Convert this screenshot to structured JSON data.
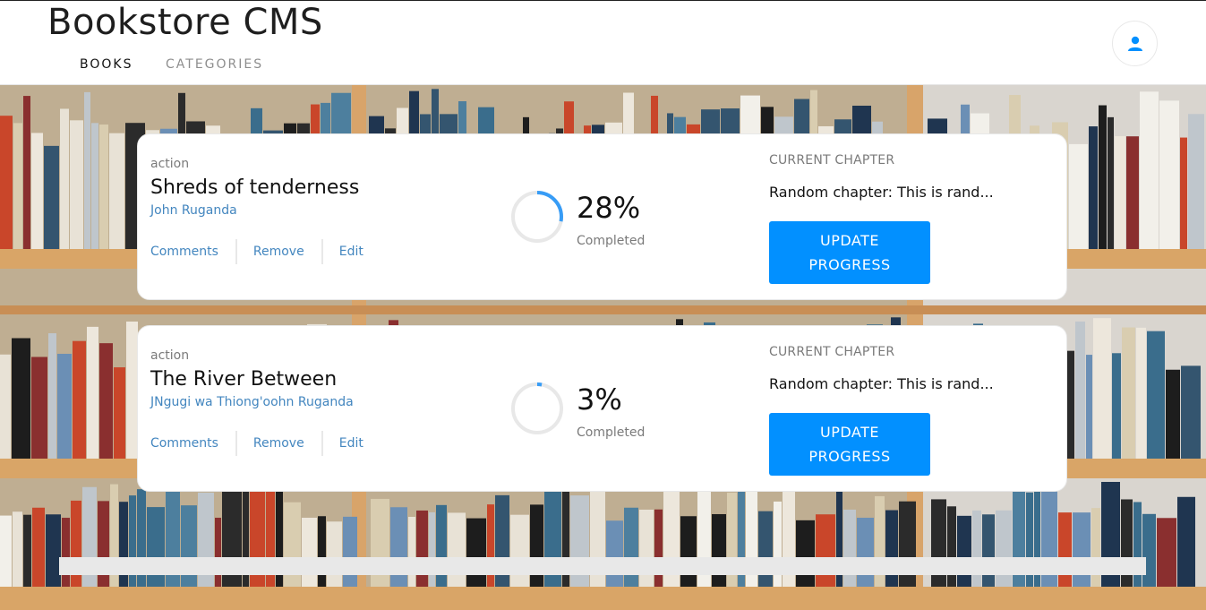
{
  "header": {
    "brand": "Bookstore CMS",
    "nav": [
      {
        "label": "BOOKS"
      },
      {
        "label": "CATEGORIES"
      }
    ],
    "user_icon": "user-icon"
  },
  "books": [
    {
      "genre": "action",
      "title": "Shreds of tenderness",
      "author": "John Ruganda",
      "actions": [
        "Comments",
        "Remove",
        "Edit"
      ],
      "progress": 28,
      "percent_label": "28%",
      "completed_label": "Completed",
      "chapter_label": "CURRENT CHAPTER",
      "chapter": "Random chapter: This is rand...",
      "button_line1": "UPDATE",
      "button_line2": "PROGRESS"
    },
    {
      "genre": "action",
      "title": "The River Between",
      "author": "JNgugi wa Thiong'oohn Ruganda",
      "actions": [
        "Comments",
        "Remove",
        "Edit"
      ],
      "progress": 3,
      "percent_label": "3%",
      "completed_label": "Completed",
      "chapter_label": "CURRENT CHAPTER",
      "chapter": "Random chapter: This is rand...",
      "button_line1": "UPDATE",
      "button_line2": "PROGRESS"
    }
  ],
  "colors": {
    "accent": "#0290ff",
    "link": "#4386bf",
    "ring_track": "#e8e8e8",
    "ring_fill": "#379cf6"
  }
}
